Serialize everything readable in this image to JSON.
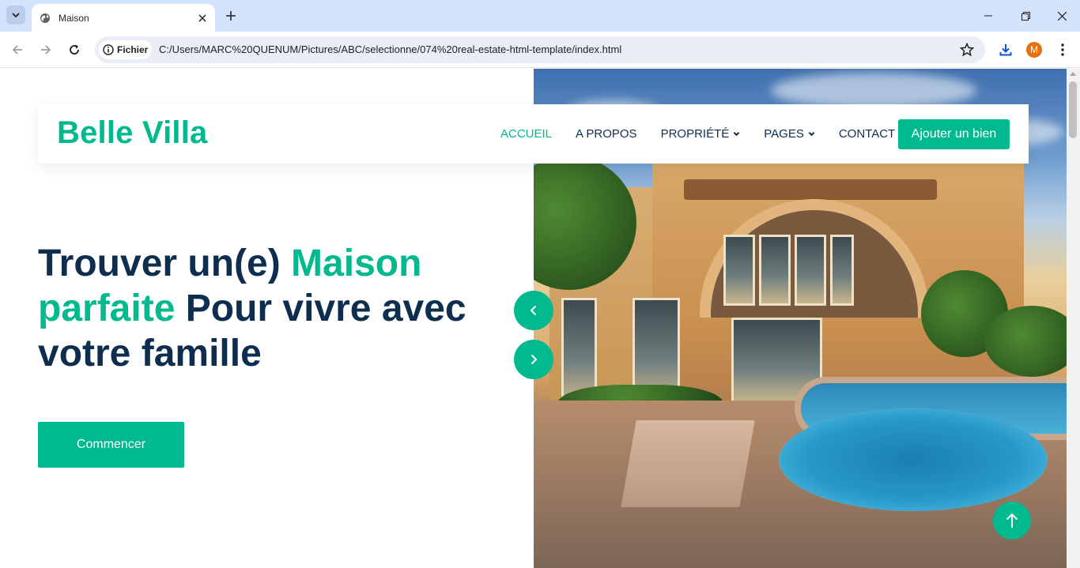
{
  "browser": {
    "tab_title": "Maison",
    "site_chip": "Fichier",
    "url": "C:/Users/MARC%20QUENUM/Pictures/ABC/selectionne/074%20real-estate-html-template/index.html",
    "profile_initial": "M"
  },
  "site": {
    "logo": "Belle Villa",
    "nav": [
      {
        "label": "ACCUEIL",
        "active": true
      },
      {
        "label": "A PROPOS"
      },
      {
        "label": "PROPRIÉTÉ",
        "dropdown": true
      },
      {
        "label": "PAGES",
        "dropdown": true
      },
      {
        "label": "CONTACT"
      }
    ],
    "add_button": "Ajouter un bien"
  },
  "hero": {
    "title_part1": "Trouver un(e) ",
    "title_accent": "Maison parfaite",
    "title_part2": " Pour vivre avec votre famille",
    "cta": "Commencer"
  },
  "colors": {
    "accent": "#00b98e",
    "heading": "#0e2e50",
    "tabbar": "#d3e3fd"
  },
  "icons": {
    "carousel_prev": "chevron-left-icon",
    "carousel_next": "chevron-right-icon",
    "back_to_top": "arrow-up-icon"
  }
}
